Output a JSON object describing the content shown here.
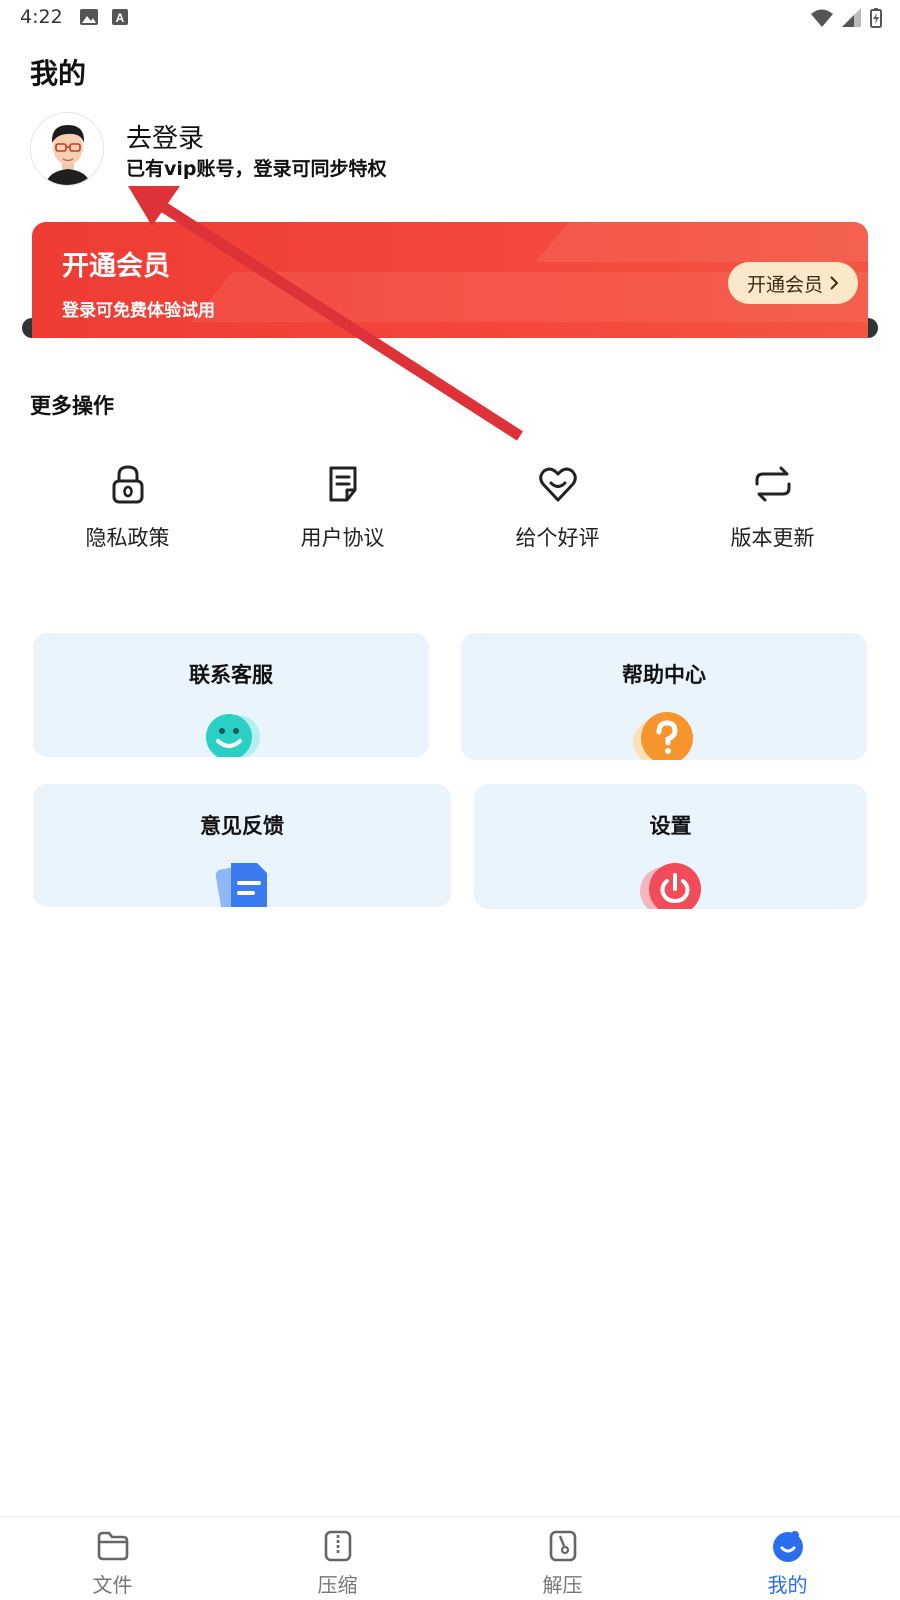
{
  "status_bar": {
    "time": "4:22"
  },
  "page_title": "我的",
  "profile": {
    "title": "去登录",
    "subtitle": "已有vip账号，登录可同步特权"
  },
  "vip_banner": {
    "title": "开通会员",
    "subtitle": "登录可免费体验试用",
    "button_label": "开通会员"
  },
  "more_section": {
    "title": "更多操作",
    "items": [
      {
        "label": "隐私政策",
        "icon": "lock-icon"
      },
      {
        "label": "用户协议",
        "icon": "document-icon"
      },
      {
        "label": "给个好评",
        "icon": "heart-icon"
      },
      {
        "label": "版本更新",
        "icon": "refresh-icon"
      }
    ]
  },
  "cards": [
    {
      "label": "联系客服",
      "icon": "smiley-icon",
      "color": "#2fcfc3"
    },
    {
      "label": "帮助中心",
      "icon": "question-icon",
      "color": "#f6952b"
    },
    {
      "label": "意见反馈",
      "icon": "feedback-document-icon",
      "color": "#3a7bf2"
    },
    {
      "label": "设置",
      "icon": "power-icon",
      "color": "#f24b5a"
    }
  ],
  "tabbar": {
    "items": [
      {
        "label": "文件",
        "icon": "folder-icon",
        "active": false
      },
      {
        "label": "压缩",
        "icon": "compress-icon",
        "active": false
      },
      {
        "label": "解压",
        "icon": "extract-icon",
        "active": false
      },
      {
        "label": "我的",
        "icon": "profile-icon",
        "active": true
      }
    ]
  },
  "colors": {
    "vip_red": "#ef3f36",
    "accent_blue": "#2b6ff0",
    "card_bg": "#eaf4fd",
    "arrow_red": "#e0343b"
  }
}
